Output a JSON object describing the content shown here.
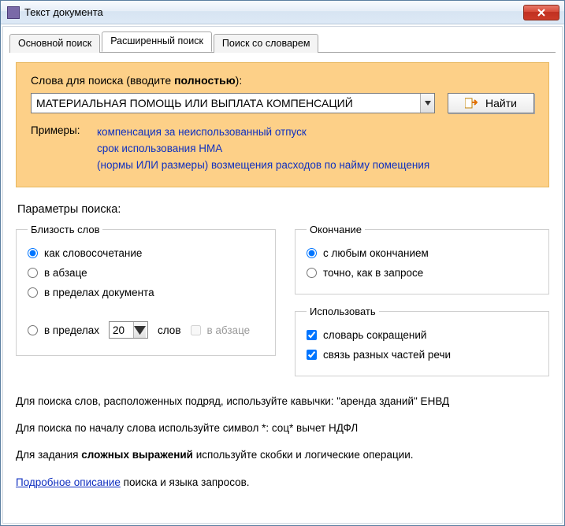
{
  "window": {
    "title": "Текст документа"
  },
  "tabs": {
    "basic": "Основной поиск",
    "extended": "Расширенный поиск",
    "dictionary": "Поиск со словарем"
  },
  "searchbox": {
    "label_prefix": "Слова для поиска (вводите ",
    "label_bold": "полностью",
    "label_suffix": "):",
    "query": "МАТЕРИАЛЬНАЯ ПОМОЩЬ ИЛИ ВЫПЛАТА КОМПЕНСАЦИЙ",
    "find_label": "Найти",
    "examples_label": "Примеры:",
    "examples": {
      "l1": "компенсация за неиспользованный отпуск",
      "l2": "срок использования НМА",
      "l3": "(нормы ИЛИ размеры) возмещения расходов по найму помещения"
    }
  },
  "params": {
    "title": "Параметры поиска:",
    "proximity": {
      "legend": "Близость слов",
      "as_phrase": "как словосочетание",
      "in_paragraph": "в абзаце",
      "in_document": "в пределах документа",
      "within_prefix": "в пределах",
      "within_value": "20",
      "within_suffix": "слов",
      "in_paragraph_cb": "в абзаце",
      "selected": "as_phrase"
    },
    "ending": {
      "legend": "Окончание",
      "any": "с любым окончанием",
      "exact": "точно, как в запросе",
      "selected": "any"
    },
    "use": {
      "legend": "Использовать",
      "abbrev": "словарь сокращений",
      "morph": "связь разных частей речи",
      "abbrev_checked": true,
      "morph_checked": true
    }
  },
  "hints": {
    "h1": "Для поиска слов, расположенных подряд, используйте кавычки: \"аренда зданий\" ЕНВД",
    "h2": "Для поиска по началу слова используйте символ *: соц* вычет НДФЛ",
    "h3_prefix": "Для задания ",
    "h3_bold": "сложных выражений",
    "h3_suffix": " используйте скобки и логические операции.",
    "link": "Подробное описание",
    "link_suffix": " поиска и языка запросов."
  }
}
